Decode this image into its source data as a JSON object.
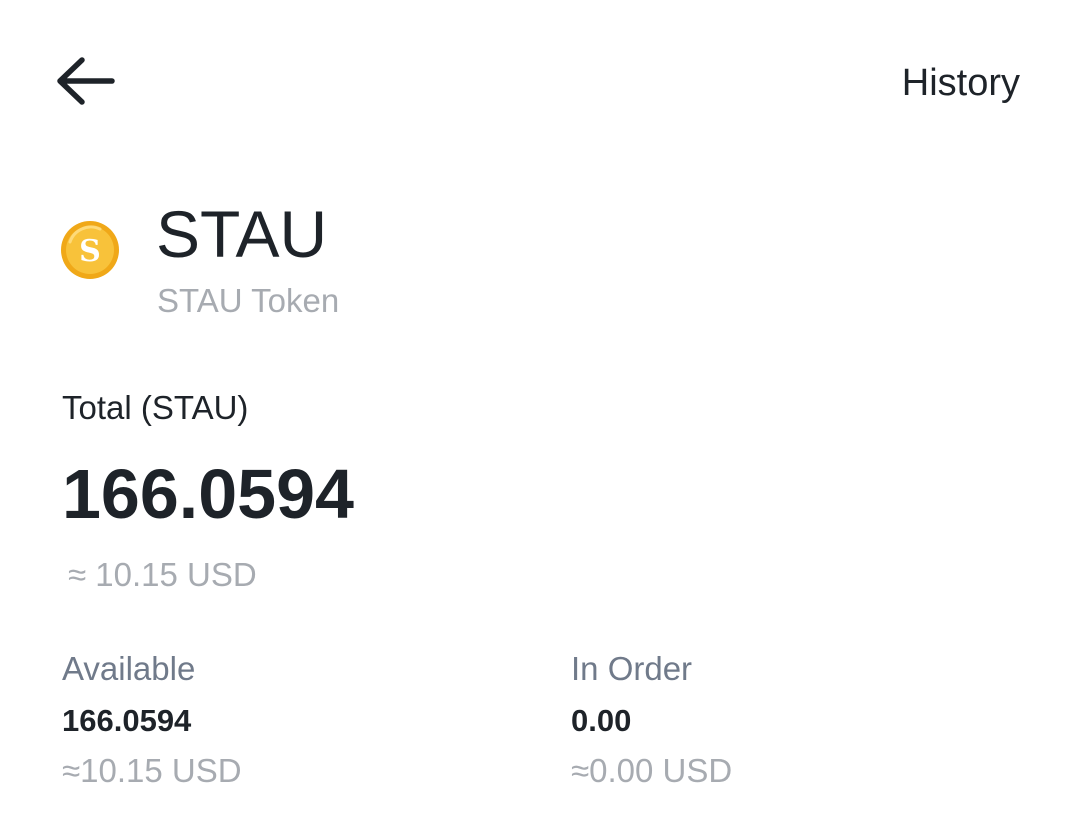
{
  "header": {
    "back_icon": "arrow-left-icon",
    "history_label": "History"
  },
  "asset": {
    "icon": "coin-s-icon",
    "icon_letter": "S",
    "symbol": "STAU",
    "name": "STAU Token",
    "colors": {
      "coin_gold": "#f4b518",
      "coin_highlight": "#ffd86a"
    }
  },
  "total": {
    "label": "Total (STAU)",
    "value": "166.0594",
    "usd": "≈ 10.15 USD"
  },
  "available": {
    "label": "Available",
    "value": "166.0594",
    "usd": "≈10.15 USD"
  },
  "in_order": {
    "label": "In Order",
    "value": "0.00",
    "usd": "≈0.00 USD"
  }
}
